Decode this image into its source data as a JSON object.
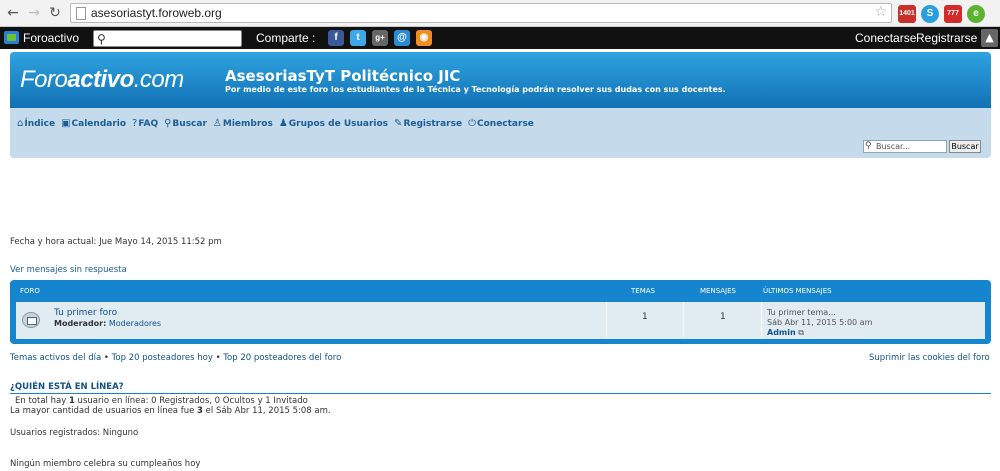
{
  "browser": {
    "url": "asesoriastyt.foroweb.org",
    "extension_badges": [
      "1401",
      "777"
    ]
  },
  "toolbar": {
    "brand": "Foroactivo",
    "share_label": "Comparte :",
    "share_icons": [
      "facebook-icon",
      "twitter-icon",
      "google-plus-icon",
      "email-icon",
      "rss-icon"
    ],
    "connect": "Conectarse",
    "register": "Registrarse"
  },
  "header": {
    "logo_text_1": "Foro",
    "logo_text_2": "activo",
    "logo_text_3": ".com",
    "title": "AsesoriasTyT Politécnico JIC",
    "description": "Por medio de este foro los estudiantes de la Técnica y Tecnología podrán resolver sus dudas con sus docentes."
  },
  "menu": {
    "items": [
      {
        "label": "Índice",
        "icon": "home-icon"
      },
      {
        "label": "Calendario",
        "icon": "calendar-icon"
      },
      {
        "label": "FAQ",
        "icon": "help-icon"
      },
      {
        "label": "Buscar",
        "icon": "search-icon"
      },
      {
        "label": "Miembros",
        "icon": "members-icon"
      },
      {
        "label": "Grupos de Usuarios",
        "icon": "groups-icon"
      },
      {
        "label": "Registrarse",
        "icon": "register-icon"
      },
      {
        "label": "Conectarse",
        "icon": "login-icon"
      }
    ],
    "search_placeholder": "Buscar...",
    "search_button": "Buscar"
  },
  "main": {
    "date_now": "Fecha y hora actual: Jue Mayo 14, 2015 11:52 pm",
    "unanswered": "Ver mensajes sin respuesta"
  },
  "forum_table": {
    "headers": {
      "forum": "FORO",
      "topics": "TEMAS",
      "posts": "MENSAJES",
      "last": "ÚLTIMOS MENSAJES"
    },
    "rows": [
      {
        "name": "Tu primer foro",
        "moderator_label": "Moderador:",
        "moderator": "Moderadores",
        "topics": "1",
        "posts": "1",
        "last_title": "Tu primer tema...",
        "last_date": "Sáb Abr 11, 2015 5:00 am",
        "last_user": "Admin"
      }
    ]
  },
  "bottom": {
    "active_topics": "Temas activos del día",
    "top20_today": "Top 20 posteadores hoy",
    "top20_forum": "Top 20 posteadores del foro",
    "separator": "•",
    "cookies": "Suprimir las cookies del foro"
  },
  "online": {
    "title": "¿QUIÉN ESTÁ EN LÍNEA?",
    "line1_a": "En total hay ",
    "line1_b": "1",
    "line1_c": " usuario en línea: 0 Registrados, 0 Ocultos y 1 Invitado",
    "line2_a": "La mayor cantidad de usuarios en línea fue ",
    "line2_b": "3",
    "line2_c": " el Sáb Abr 11, 2015 5:08 am.",
    "registered": "Usuarios registrados: Ninguno",
    "birthdays": "Ningún miembro celebra su cumpleaños hoy"
  }
}
